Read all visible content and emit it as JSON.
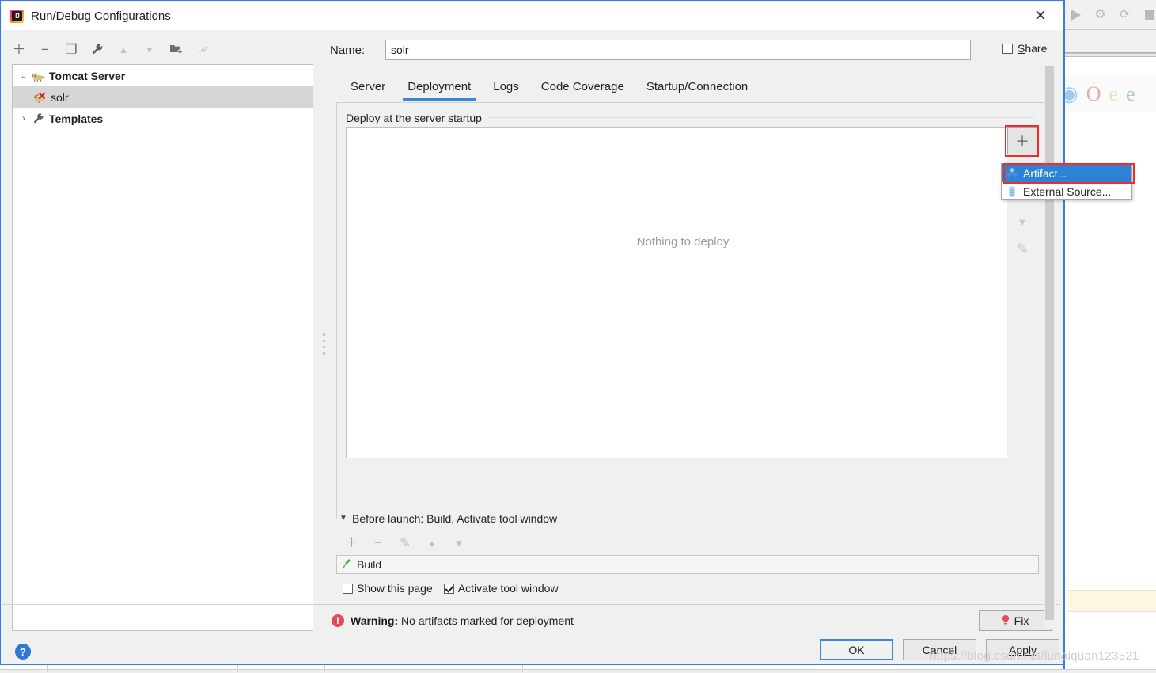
{
  "background": {
    "toolbar_icons": [
      "run-icon",
      "debug-icon",
      "rerun-coverage-icon",
      "stop-icon"
    ],
    "browser_icons": [
      "chrome-icon",
      "opera-icon",
      "internet-explorer-icon",
      "edge-icon"
    ],
    "debug_glyph": "⚙",
    "rerun_glyph": "⟳",
    "opera_glyph": "O",
    "ie_glyph": "e",
    "edge_glyph": "e"
  },
  "dialog": {
    "title": "Run/Debug Configurations",
    "app_icon": "intellij-idea-icon",
    "close_glyph": "✕"
  },
  "left_toolbar": {
    "items": [
      {
        "name": "add-configuration-button",
        "glyph": "＋",
        "dim": false
      },
      {
        "name": "remove-configuration-button",
        "glyph": "−",
        "dim": false
      },
      {
        "name": "copy-configuration-button",
        "glyph": "❐",
        "dim": false
      },
      {
        "name": "edit-templates-button",
        "glyph": "🔧",
        "dim": false
      },
      {
        "name": "move-up-button",
        "glyph": "▲",
        "dim": true
      },
      {
        "name": "move-down-button",
        "glyph": "▼",
        "dim": true
      },
      {
        "name": "create-folder-button",
        "glyph": "📁",
        "dim": false
      },
      {
        "name": "sort-configurations-button",
        "glyph": "↓ᴀᶻ",
        "dim": true
      }
    ]
  },
  "tree": {
    "nodes": [
      {
        "label": "Tomcat Server",
        "twisty": "⌄",
        "icon": "tomcat-icon",
        "bold": true,
        "selected": false,
        "indent": 0
      },
      {
        "label": "solr",
        "twisty": "",
        "icon": "tomcat-error-icon",
        "bold": false,
        "selected": true,
        "indent": 1
      },
      {
        "label": "Templates",
        "twisty": "›",
        "icon": "wrench-icon",
        "bold": true,
        "selected": false,
        "indent": 0
      }
    ]
  },
  "help": {
    "glyph": "?",
    "name": "help-button"
  },
  "name_field": {
    "label": "Name:",
    "value": "solr",
    "placeholder": ""
  },
  "share": {
    "label_pre": "S",
    "label_post": "hare",
    "checked": false
  },
  "tabs": [
    {
      "label": "Server",
      "active": false
    },
    {
      "label": "Deployment",
      "active": true
    },
    {
      "label": "Logs",
      "active": false
    },
    {
      "label": "Code Coverage",
      "active": false
    },
    {
      "label": "Startup/Connection",
      "active": false
    }
  ],
  "deploy": {
    "legend": "Deploy at the server startup",
    "empty_text": "Nothing to deploy",
    "toolbar": [
      {
        "name": "deploy-add-button",
        "glyph": "＋",
        "dim": false,
        "highlighted": true
      },
      {
        "name": "deploy-remove-button",
        "glyph": "−",
        "dim": true,
        "highlighted": false
      },
      {
        "name": "deploy-move-up-button",
        "glyph": "▲",
        "dim": true,
        "highlighted": false
      },
      {
        "name": "deploy-move-down-button",
        "glyph": "▼",
        "dim": true,
        "highlighted": false
      },
      {
        "name": "deploy-edit-button",
        "glyph": "✎",
        "dim": true,
        "highlighted": false
      }
    ]
  },
  "popup_menu": {
    "items": [
      {
        "label": "Artifact...",
        "icon": "artifact-icon",
        "selected": true
      },
      {
        "label": "External Source...",
        "icon": "external-source-icon",
        "selected": false
      }
    ]
  },
  "before_launch": {
    "caret": "▼",
    "label": "Before launch: Build, Activate tool window",
    "toolbar": [
      {
        "name": "before-launch-add-button",
        "glyph": "＋",
        "dim": false
      },
      {
        "name": "before-launch-remove-button",
        "glyph": "−",
        "dim": true
      },
      {
        "name": "before-launch-edit-button",
        "glyph": "✎",
        "dim": true
      },
      {
        "name": "before-launch-move-up-button",
        "glyph": "▲",
        "dim": true
      },
      {
        "name": "before-launch-move-down-button",
        "glyph": "▼",
        "dim": true
      }
    ],
    "task": {
      "label": "Build",
      "icon": "build-hammer-icon"
    },
    "checkboxes": [
      {
        "label": "Show this page",
        "checked": false,
        "name": "show-this-page-checkbox"
      },
      {
        "label": "Activate tool window",
        "checked": true,
        "name": "activate-tool-window-checkbox"
      }
    ]
  },
  "warning": {
    "icon": "warning-icon",
    "icon_glyph": "!",
    "prefix": "Warning:",
    "message": "No artifacts marked for deployment",
    "fix_label": "Fix",
    "fix_icon": "lightbulb-icon"
  },
  "buttons": [
    {
      "label": "OK",
      "default": true,
      "name": "ok-button"
    },
    {
      "label": "Cancel",
      "default": false,
      "name": "cancel-button"
    },
    {
      "label": "Apply",
      "default": false,
      "name": "apply-button"
    }
  ],
  "watermark": "https://blog.csdn.net/lunaiquan123521",
  "colors": {
    "accent_blue": "#3c86d4",
    "selection_blue": "#2d82d6",
    "highlight_red": "#ef2b2b",
    "warning_red": "#e04a59",
    "dialog_bg": "#f0f0f0"
  }
}
